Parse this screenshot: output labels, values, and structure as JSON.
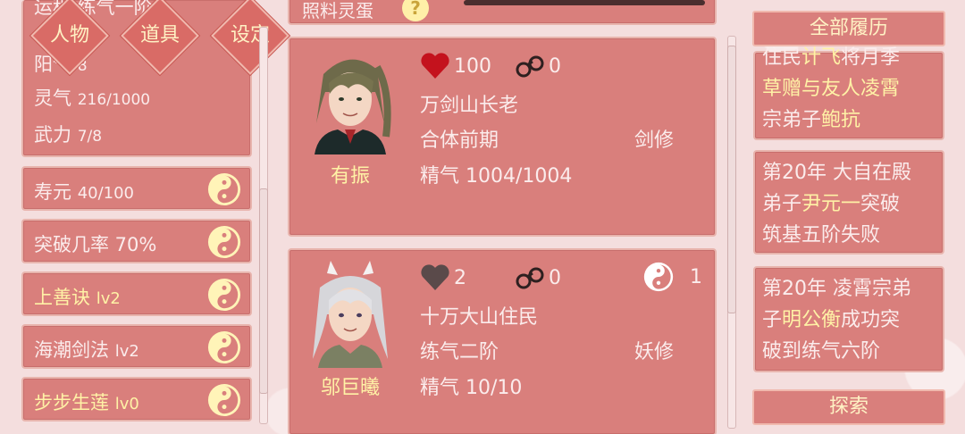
{
  "stats": {
    "row1": "运程 练气一阶",
    "row2_label": "阳气",
    "row2_value": "8",
    "row3_label": "灵气",
    "row3_value": "216/1000",
    "row4_label": "武力",
    "row4_value": "7/8"
  },
  "tabs": [
    {
      "label": "人物"
    },
    {
      "label": "道具"
    },
    {
      "label": "设定"
    }
  ],
  "skills": [
    {
      "label": "寿元",
      "value": "40/100"
    },
    {
      "label": "突破几率 70%"
    },
    {
      "label": "上善诀",
      "value": "lv2"
    },
    {
      "label": "海潮剑法",
      "value": "lv2"
    },
    {
      "label": "步步生莲",
      "value": "lv0"
    }
  ],
  "top_partial": {
    "label": "照料灵蛋",
    "icon": "question-icon"
  },
  "characters": [
    {
      "name": "有振",
      "hearts": "100",
      "cuffs": "0",
      "title": "万剑山长老",
      "realm": "合体前期",
      "class": "剑修",
      "essence_label": "精气",
      "essence_value": "1004/1004"
    },
    {
      "name": "邬巨曦",
      "hearts": "2",
      "cuffs": "0",
      "yinyang_count": "1",
      "title": "十万大山住民",
      "realm": "练气二阶",
      "class": "妖修",
      "essence_label": "精气",
      "essence_value": "10/10"
    }
  ],
  "history": {
    "header": "全部履历",
    "entries": [
      {
        "p1": "住民",
        "h1": "计飞",
        "p2": "将月季",
        "p3": "草赠与友人凌霄",
        "p4": "宗弟子",
        "h2": "鲍抗"
      },
      {
        "p1": "第20年 大自在殿",
        "p2": "弟子",
        "h1": "尹元一",
        "p3": "突破",
        "p4": "筑基五阶失败"
      },
      {
        "p1": "第20年 凌霄宗弟",
        "p2": "子",
        "h1": "明公衡",
        "p3": "成功突",
        "p4": "破到练气六阶"
      }
    ],
    "explore": "探索"
  },
  "colors": {
    "panel": "#d97f7c",
    "gold_text": "#fff2a6",
    "light_text": "#fbecec",
    "heart_red": "#c4121d",
    "heart_gray": "#5a4a4a"
  }
}
